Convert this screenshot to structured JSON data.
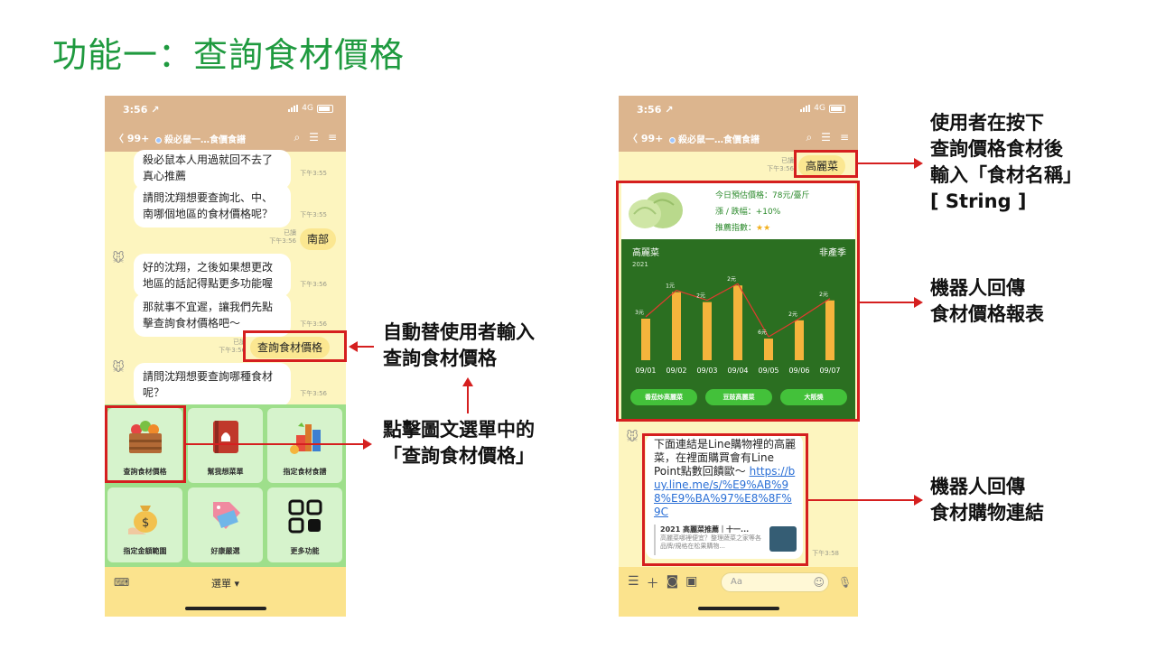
{
  "slide": {
    "title": "功能一：查詢食材價格"
  },
  "phone_left": {
    "status_time": "3:56 ↗",
    "network": "4G",
    "nav": {
      "back": "〈 99+",
      "title": "殺必鼠一…食價食譜"
    },
    "messages": [
      {
        "text": "殺必鼠本人用過就回不去了\n真心推薦",
        "time": "下午3:55"
      },
      {
        "text": "請問沈翔想要查詢北、中、\n南哪個地區的食材價格呢？",
        "time": "下午3:55"
      },
      {
        "text": "南部",
        "time": "已讀\n下午3:56"
      },
      {
        "text": "好的沈翔，之後如果想更改\n地區的話記得點更多功能喔",
        "time": "下午3:56"
      },
      {
        "text": "那就事不宜遲，讓我們先點\n擊查詢食材價格吧～",
        "time": "下午3:56"
      },
      {
        "text": "查詢食材價格",
        "time": "已讀\n下午3:56"
      },
      {
        "text": "請問沈翔想要查詢哪種食材\n呢？",
        "time": "下午3:56"
      }
    ],
    "rich_menu": [
      {
        "label": "查詢食材價格"
      },
      {
        "label": "幫我想菜單"
      },
      {
        "label": "指定食材食譜"
      },
      {
        "label": "指定金額範圍"
      },
      {
        "label": "好康嚴選"
      },
      {
        "label": "更多功能"
      }
    ],
    "menu_footer": "選單 ▾"
  },
  "annotations": {
    "auto_input": "自動替使用者輸入\n查詢食材價格",
    "click_menu": "點擊圖文選單中的\n「查詢食材價格」",
    "user_input": "使用者在按下\n查詢價格食材後\n輸入「食材名稱」\n[ String ]",
    "bot_report": "機器人回傳\n食材價格報表",
    "bot_link": "機器人回傳\n食材購物連結"
  },
  "phone_right": {
    "status_time": "3:56 ↗",
    "network": "4G",
    "nav": {
      "back": "〈 99+",
      "title": "殺必鼠一…食價食譜"
    },
    "user_msg": {
      "text": "高麗菜",
      "time": "已讀\n下午3:56"
    },
    "price_info": {
      "today_price": "今日預估價格：78元/臺斤",
      "change": "漲 / 跌幅：+10%",
      "recommend": "推薦指數：",
      "stars": "★★"
    },
    "chart_data": {
      "type": "bar",
      "title": "高麗菜",
      "subtitle": "2021",
      "badge": "非產季",
      "categories": [
        "09/01",
        "09/02",
        "09/03",
        "09/04",
        "09/05",
        "09/06",
        "09/07"
      ],
      "values": [
        50,
        82,
        70,
        90,
        26,
        48,
        72
      ],
      "change_labels": [
        "3元",
        "1元",
        "2元",
        "2元",
        "6元",
        "2元",
        "2元"
      ],
      "ylim": [
        0,
        100
      ],
      "bar_color": "#f5b43c",
      "trend_color": "#e23b2f"
    },
    "recipes": [
      "番茄炒高麗菜",
      "豆豉高麗菜",
      "大阪燒"
    ],
    "link_msg": {
      "text": "下面連結是Line購物裡的高麗菜，在裡面購買會有Line Point點數回饋歐～ ",
      "url": "https://buy.line.me/s/%E9%AB%98%E9%BA%97%E8%8F%9C",
      "preview_title": "2021 高麗菜推薦｜十一...",
      "preview_desc": "高麗菜哪裡便宜？整理蔬菜之家等各品牌/規格在松果購物...",
      "time": "下午3:58"
    },
    "input_placeholder": "Aa"
  }
}
